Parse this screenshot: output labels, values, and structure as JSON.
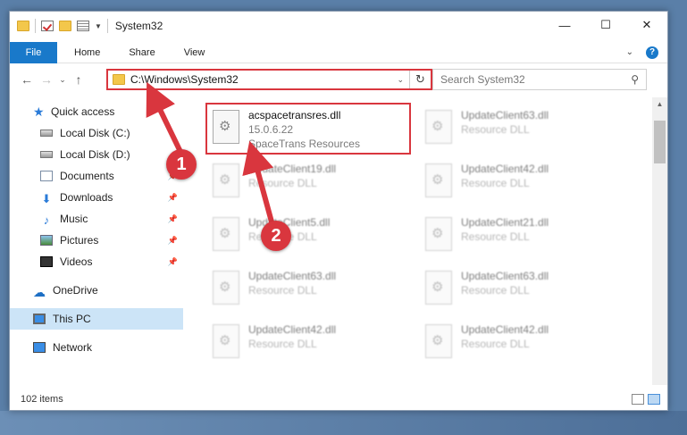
{
  "titlebar": {
    "title": "System32"
  },
  "window_controls": {
    "minimize": "—",
    "maximize": "☐",
    "close": "✕"
  },
  "menu": {
    "file": "File",
    "home": "Home",
    "share": "Share",
    "view": "View",
    "help": "?"
  },
  "address": {
    "path": "C:\\Windows\\System32"
  },
  "search": {
    "placeholder": "Search System32"
  },
  "sidebar": {
    "items": [
      {
        "label": "Quick access"
      },
      {
        "label": "Local Disk (C:)"
      },
      {
        "label": "Local Disk (D:)"
      },
      {
        "label": "Documents"
      },
      {
        "label": "Downloads"
      },
      {
        "label": "Music"
      },
      {
        "label": "Pictures"
      },
      {
        "label": "Videos"
      },
      {
        "label": "OneDrive"
      },
      {
        "label": "This PC"
      },
      {
        "label": "Network"
      }
    ]
  },
  "files": [
    {
      "name": "acspacetransres.dll",
      "line2": "15.0.6.22",
      "line3": "SpaceTrans Resources"
    },
    {
      "name": "UpdateClient63.dll",
      "line2": "Resource DLL"
    },
    {
      "name": "UpdateClient19.dll",
      "line2": "Resource DLL"
    },
    {
      "name": "UpdateClient42.dll",
      "line2": "Resource DLL"
    },
    {
      "name": "UpdateClient5.dll",
      "line2": "Resource DLL"
    },
    {
      "name": "UpdateClient21.dll",
      "line2": "Resource DLL"
    },
    {
      "name": "UpdateClient63.dll",
      "line2": "Resource DLL"
    },
    {
      "name": "UpdateClient63.dll",
      "line2": "Resource DLL"
    },
    {
      "name": "UpdateClient42.dll",
      "line2": "Resource DLL"
    },
    {
      "name": "UpdateClient42.dll",
      "line2": "Resource DLL"
    }
  ],
  "status": {
    "count": "102 items"
  },
  "callouts": {
    "one": "1",
    "two": "2"
  },
  "colors": {
    "accent": "#1979ca",
    "highlight": "#d9363e",
    "selected": "#cce4f7"
  }
}
